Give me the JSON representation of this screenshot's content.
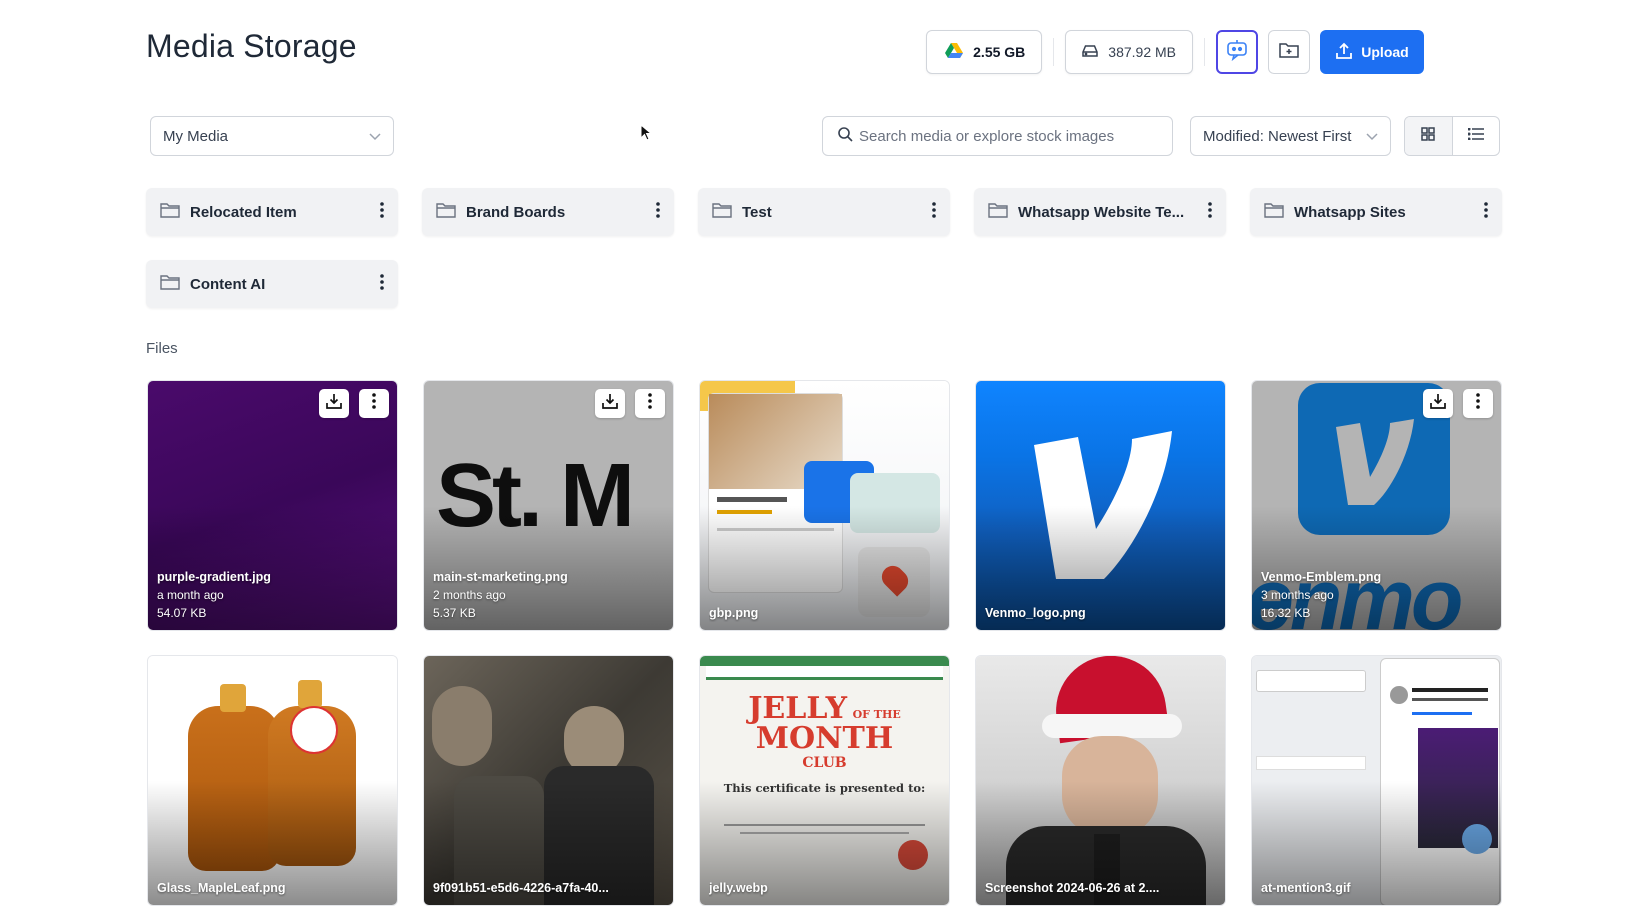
{
  "header": {
    "title": "Media Storage",
    "google_drive_usage": "2.55 GB",
    "local_storage_usage": "387.92 MB",
    "upload_label": "Upload"
  },
  "toolbar": {
    "source_select": "My Media",
    "search_placeholder": "Search media or explore stock images",
    "sort_select": "Modified: Newest First"
  },
  "folders": [
    {
      "name": "Relocated Item"
    },
    {
      "name": "Brand Boards"
    },
    {
      "name": "Test"
    },
    {
      "name": "Whatsapp Website Te..."
    },
    {
      "name": "Whatsapp Sites"
    },
    {
      "name": "Content AI"
    }
  ],
  "files_section_label": "Files",
  "files": [
    {
      "name": "purple-gradient.jpg",
      "modified": "a month ago",
      "size": "54.07 KB"
    },
    {
      "name": "main-st-marketing.png",
      "modified": "2 months ago",
      "size": "5.37 KB",
      "art_text": "St. M"
    },
    {
      "name": "gbp.png"
    },
    {
      "name": "Venmo_logo.png"
    },
    {
      "name": "Venmo-Emblem.png",
      "modified": "3 months ago",
      "size": "16.32 KB"
    },
    {
      "name": "Glass_MapleLeaf.png"
    },
    {
      "name": "9f091b51-e5d6-4226-a7fa-40..."
    },
    {
      "name": "jelly.webp",
      "art_title_1": "JELLY",
      "art_title_2": "OF THE",
      "art_title_3": "MONTH",
      "art_title_4": "CLUB",
      "art_line": "This certificate is presented to:"
    },
    {
      "name": "Screenshot 2024-06-26 at 2...."
    },
    {
      "name": "at-mention3.gif"
    }
  ],
  "colors": {
    "accent": "#1d6ff2",
    "ai_button_border": "#4f46e5",
    "folder_bg": "#f1f2f4"
  }
}
